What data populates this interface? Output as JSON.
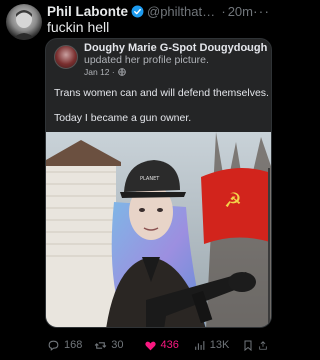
{
  "tweet": {
    "author_name": "Phil Labonte",
    "handle": "@philthatre...",
    "separator": "·",
    "time": "20m",
    "text": "fuckin hell",
    "more": "···"
  },
  "embed": {
    "author": "Doughy Marie G-Spot Dougydough",
    "action": "updated her profile picture.",
    "date": "Jan 12 ·",
    "more": "···",
    "line1": "Trans women can and will defend themselves.",
    "line2": "Today I became a gun owner.",
    "hat_text": "PLANET",
    "flag_emblem": "☭"
  },
  "actions": {
    "replies": "168",
    "retweets": "30",
    "likes": "436",
    "views": "13K"
  },
  "colors": {
    "background": "#000000",
    "like_pink": "#f91880",
    "verified_blue": "#1d9bf0",
    "flag_red": "#d2241c"
  }
}
